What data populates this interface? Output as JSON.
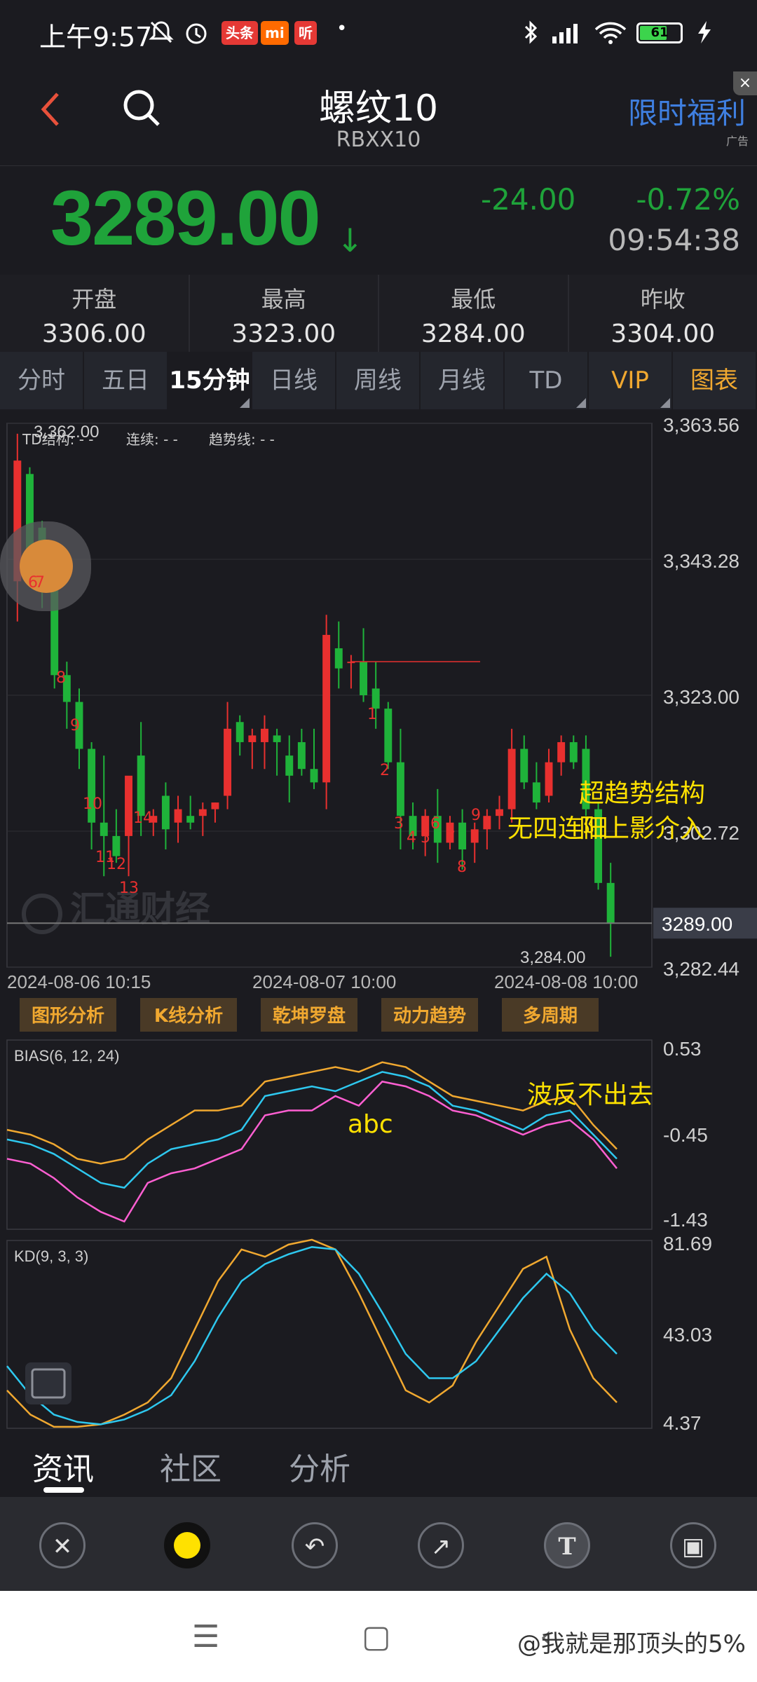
{
  "status_bar": {
    "time": "上午9:57",
    "badges": [
      {
        "text": "头条",
        "color": "#e53935"
      },
      {
        "text": "mi",
        "color": "#ff6a00"
      },
      {
        "text": "听",
        "color": "#e53935"
      }
    ],
    "battery": "61"
  },
  "header": {
    "back_icon": "chevron-left-icon",
    "search_icon": "search-icon",
    "title": "螺纹10",
    "subtitle": "RBXX10",
    "promo": "限时福利",
    "ad_tag": "广告",
    "close": "×"
  },
  "quote": {
    "price": "3289.00",
    "arrow": "↓",
    "change": "-24.00",
    "change_pct": "-0.72%",
    "time": "09:54:38",
    "color": "#1fa33a"
  },
  "stats": [
    {
      "label": "开盘",
      "value": "3306.00"
    },
    {
      "label": "最高",
      "value": "3323.00"
    },
    {
      "label": "最低",
      "value": "3284.00"
    },
    {
      "label": "昨收",
      "value": "3304.00"
    }
  ],
  "tabs": [
    {
      "label": "分时"
    },
    {
      "label": "五日"
    },
    {
      "label": "15分钟"
    },
    {
      "label": "日线"
    },
    {
      "label": "周线"
    },
    {
      "label": "月线"
    },
    {
      "label": "TD"
    },
    {
      "label": "VIP"
    },
    {
      "label": "图表"
    }
  ],
  "active_tab": "15分钟",
  "main_chart": {
    "info": {
      "td": "TD结构: - -",
      "cont": "连续: - -",
      "trend": "趋势线: - -"
    },
    "y_ticks": [
      "3,363.56",
      "3,343.28",
      "3,323.00",
      "3,302.72",
      "3,282.44"
    ],
    "x_ticks": [
      "2024-08-06 10:15",
      "2024-08-07 10:00",
      "2024-08-08 10:00"
    ],
    "current_price_tag": "3289.00",
    "high_label": "3,362.00",
    "low_label": "3,284.00",
    "watermark": "汇通财经",
    "annotations": [
      "超趋势结构",
      "无四连阳",
      "阳上影介入"
    ],
    "td_labels": [
      "6",
      "7",
      "8",
      "9",
      "10",
      "11",
      "12",
      "13",
      "14",
      "1",
      "2",
      "3",
      "4",
      "5",
      "6",
      "7",
      "8",
      "9"
    ],
    "ranged": {
      "ymin": 3282.44,
      "ymax": 3363.56
    }
  },
  "tools": [
    "图形分析",
    "K线分析",
    "乾坤罗盘",
    "动力趋势",
    "多周期"
  ],
  "bias_chart": {
    "label": "BIAS(6, 12, 24)",
    "y_ticks": [
      "0.53",
      "-0.45",
      "-1.43"
    ],
    "annotations": [
      "abc",
      "波反不出去"
    ]
  },
  "kd_chart": {
    "label": "KD(9, 3, 3)",
    "y_ticks": [
      "81.69",
      "43.03",
      "4.37"
    ]
  },
  "bottom_tabs": [
    {
      "label": "资讯"
    },
    {
      "label": "社区"
    },
    {
      "label": "分析"
    }
  ],
  "toolbar_icons": [
    "close-icon",
    "color-dot-icon",
    "undo-icon",
    "arrow-icon",
    "text-icon",
    "save-icon"
  ],
  "nav": {
    "menu": "☰",
    "home": "▢",
    "back": "‹"
  },
  "watermark_text": "@我就是那顶头的5%",
  "chart_data": {
    "type": "candlestick",
    "title": "",
    "ylim": [
      3282.44,
      3363.56
    ],
    "x_ticks": [
      "2024-08-06 10:15",
      "2024-08-07 10:00",
      "2024-08-08 10:00"
    ],
    "candles": [
      {
        "o": 3340,
        "h": 3362,
        "l": 3334,
        "c": 3358
      },
      {
        "o": 3356,
        "h": 3357,
        "l": 3342,
        "c": 3344
      },
      {
        "o": 3348,
        "h": 3349,
        "l": 3336,
        "c": 3340
      },
      {
        "o": 3340,
        "h": 3343,
        "l": 3324,
        "c": 3326
      },
      {
        "o": 3326,
        "h": 3328,
        "l": 3318,
        "c": 3322
      },
      {
        "o": 3322,
        "h": 3324,
        "l": 3312,
        "c": 3315
      },
      {
        "o": 3315,
        "h": 3316,
        "l": 3300,
        "c": 3304
      },
      {
        "o": 3304,
        "h": 3314,
        "l": 3296,
        "c": 3302
      },
      {
        "o": 3302,
        "h": 3306,
        "l": 3298,
        "c": 3299
      },
      {
        "o": 3302,
        "h": 3310,
        "l": 3296,
        "c": 3311
      },
      {
        "o": 3314,
        "h": 3319,
        "l": 3302,
        "c": 3305
      },
      {
        "o": 3304,
        "h": 3306,
        "l": 3302,
        "c": 3305
      },
      {
        "o": 3308,
        "h": 3310,
        "l": 3300,
        "c": 3303
      },
      {
        "o": 3304,
        "h": 3308,
        "l": 3301,
        "c": 3306
      },
      {
        "o": 3305,
        "h": 3308,
        "l": 3303,
        "c": 3304
      },
      {
        "o": 3305,
        "h": 3307,
        "l": 3302,
        "c": 3306
      },
      {
        "o": 3306,
        "h": 3307,
        "l": 3304,
        "c": 3307
      },
      {
        "o": 3308,
        "h": 3322,
        "l": 3306,
        "c": 3318
      },
      {
        "o": 3319,
        "h": 3320,
        "l": 3314,
        "c": 3316
      },
      {
        "o": 3316,
        "h": 3318,
        "l": 3312,
        "c": 3317
      },
      {
        "o": 3316,
        "h": 3320,
        "l": 3312,
        "c": 3318
      },
      {
        "o": 3317,
        "h": 3318,
        "l": 3311,
        "c": 3316
      },
      {
        "o": 3314,
        "h": 3317,
        "l": 3307,
        "c": 3311
      },
      {
        "o": 3316,
        "h": 3318,
        "l": 3311,
        "c": 3312
      },
      {
        "o": 3312,
        "h": 3318,
        "l": 3309,
        "c": 3310
      },
      {
        "o": 3310,
        "h": 3335,
        "l": 3306,
        "c": 3332
      },
      {
        "o": 3330,
        "h": 3334,
        "l": 3324,
        "c": 3327
      },
      {
        "o": 3328,
        "h": 3329,
        "l": 3324,
        "c": 3328
      },
      {
        "o": 3328,
        "h": 3333,
        "l": 3322,
        "c": 3323
      },
      {
        "o": 3324,
        "h": 3328,
        "l": 3318,
        "c": 3321
      },
      {
        "o": 3321,
        "h": 3322,
        "l": 3312,
        "c": 3313
      },
      {
        "o": 3313,
        "h": 3318,
        "l": 3300,
        "c": 3305
      },
      {
        "o": 3305,
        "h": 3307,
        "l": 3300,
        "c": 3302
      },
      {
        "o": 3302,
        "h": 3306,
        "l": 3299,
        "c": 3305
      },
      {
        "o": 3305,
        "h": 3309,
        "l": 3298,
        "c": 3301
      },
      {
        "o": 3301,
        "h": 3305,
        "l": 3300,
        "c": 3304
      },
      {
        "o": 3304,
        "h": 3306,
        "l": 3297,
        "c": 3300
      },
      {
        "o": 3301,
        "h": 3304,
        "l": 3298,
        "c": 3303
      },
      {
        "o": 3303,
        "h": 3306,
        "l": 3300,
        "c": 3305
      },
      {
        "o": 3305,
        "h": 3308,
        "l": 3303,
        "c": 3306
      },
      {
        "o": 3306,
        "h": 3318,
        "l": 3304,
        "c": 3315
      },
      {
        "o": 3315,
        "h": 3317,
        "l": 3309,
        "c": 3310
      },
      {
        "o": 3310,
        "h": 3313,
        "l": 3306,
        "c": 3307
      },
      {
        "o": 3308,
        "h": 3315,
        "l": 3307,
        "c": 3313
      },
      {
        "o": 3313,
        "h": 3317,
        "l": 3311,
        "c": 3316
      },
      {
        "o": 3316,
        "h": 3317,
        "l": 3312,
        "c": 3313
      },
      {
        "o": 3315,
        "h": 3317,
        "l": 3305,
        "c": 3306
      },
      {
        "o": 3306,
        "h": 3307,
        "l": 3294,
        "c": 3295
      },
      {
        "o": 3295,
        "h": 3298,
        "l": 3284,
        "c": 3289
      }
    ],
    "bias": {
      "series": [
        {
          "name": "6",
          "color": "#ff5fd2",
          "values": [
            -0.7,
            -0.75,
            -0.9,
            -1.1,
            -1.25,
            -1.35,
            -0.95,
            -0.85,
            -0.8,
            -0.7,
            -0.6,
            -0.25,
            -0.2,
            -0.2,
            -0.05,
            -0.15,
            0.1,
            0.05,
            -0.05,
            -0.2,
            -0.25,
            -0.35,
            -0.45,
            -0.35,
            -0.3,
            -0.5,
            -0.8
          ]
        },
        {
          "name": "12",
          "color": "#2ec8ef",
          "values": [
            -0.5,
            -0.55,
            -0.65,
            -0.8,
            -0.95,
            -1.0,
            -0.75,
            -0.6,
            -0.55,
            -0.5,
            -0.4,
            -0.05,
            0.0,
            0.05,
            0.0,
            0.1,
            0.2,
            0.15,
            0.05,
            -0.15,
            -0.2,
            -0.3,
            -0.4,
            -0.25,
            -0.2,
            -0.45,
            -0.7
          ]
        },
        {
          "name": "24",
          "color": "#f0a830",
          "values": [
            -0.4,
            -0.45,
            -0.55,
            -0.7,
            -0.75,
            -0.7,
            -0.5,
            -0.35,
            -0.2,
            -0.2,
            -0.15,
            0.1,
            0.15,
            0.2,
            0.25,
            0.2,
            0.3,
            0.25,
            0.1,
            -0.05,
            -0.1,
            -0.15,
            -0.2,
            -0.1,
            -0.05,
            -0.35,
            -0.6
          ]
        }
      ]
    },
    "kd": {
      "series": [
        {
          "name": "K",
          "color": "#f0a830",
          "values": [
            20,
            10,
            5,
            5,
            6,
            10,
            15,
            25,
            45,
            65,
            78,
            75,
            80,
            82,
            78,
            60,
            40,
            20,
            15,
            22,
            40,
            55,
            70,
            75,
            45,
            25,
            15
          ]
        },
        {
          "name": "D",
          "color": "#2ec8ef",
          "values": [
            30,
            18,
            10,
            7,
            6,
            8,
            12,
            18,
            32,
            50,
            65,
            72,
            76,
            79,
            78,
            68,
            52,
            35,
            25,
            25,
            32,
            45,
            58,
            68,
            60,
            45,
            35
          ]
        }
      ]
    }
  }
}
